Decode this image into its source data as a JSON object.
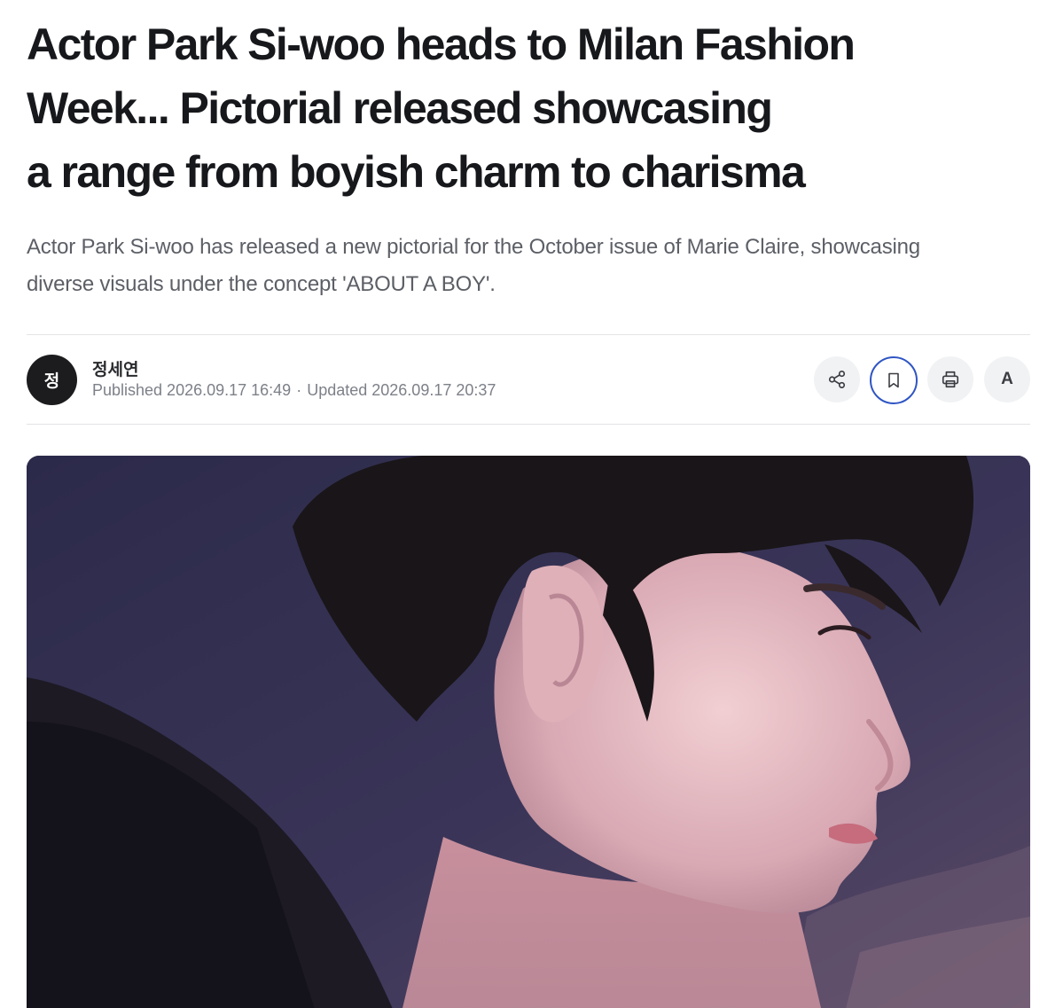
{
  "article": {
    "headline_lines": [
      "Actor Park Si-woo heads to Milan Fashion",
      "Week... Pictorial released showcasing",
      "a range from boyish charm to charisma"
    ],
    "summary_lines": [
      "Actor Park Si-woo has released a new pictorial for the October issue of Marie Claire, showcasing",
      "diverse visuals under the concept 'ABOUT A BOY'."
    ]
  },
  "author": {
    "avatar_initial": "정",
    "name": "정세연",
    "published": "Published 2026.09.17 16:49",
    "separator": "·",
    "updated": "Updated 2026.09.17 20:37"
  },
  "actions": {
    "share_icon": "share-icon",
    "bookmark_icon": "bookmark-icon",
    "bookmark_color": "#2f55c4",
    "print_icon": "print-icon",
    "font_size_label": "A"
  },
  "photo": {
    "subject": "profile-portrait"
  }
}
